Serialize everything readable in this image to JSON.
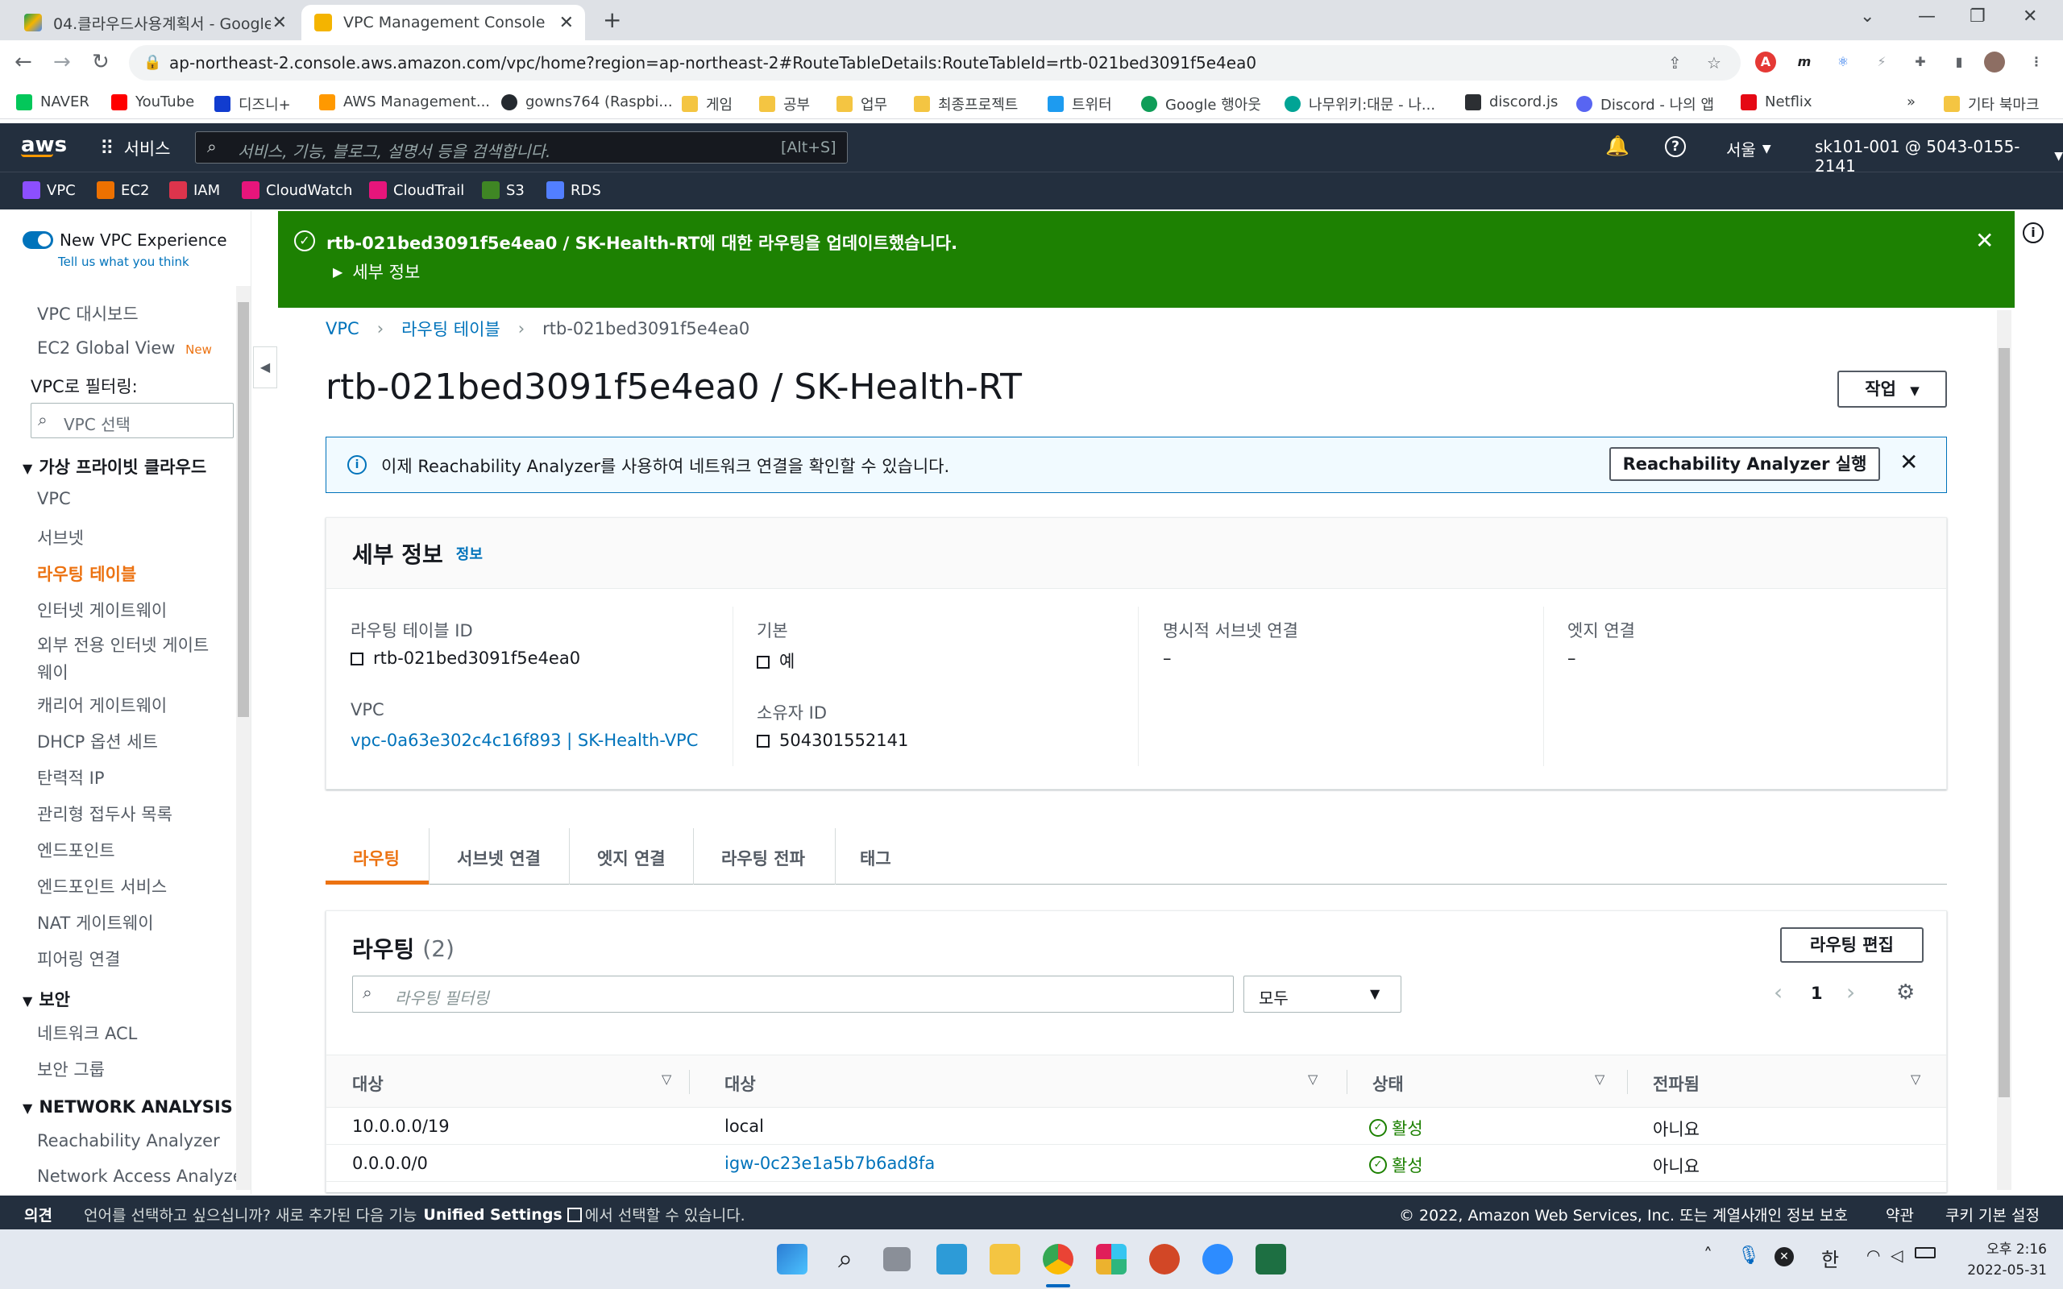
{
  "browser": {
    "tabs": [
      {
        "title": "04.클라우드사용계획서 - Google"
      },
      {
        "title": "VPC Management Console"
      }
    ],
    "url": "ap-northeast-2.console.aws.amazon.com/vpc/home?region=ap-northeast-2#RouteTableDetails:RouteTableId=rtb-021bed3091f5e4ea0",
    "bookmarks": [
      "NAVER",
      "YouTube",
      "디즈니+",
      "AWS Management...",
      "gowns764 (Raspbi...",
      "게임",
      "공부",
      "업무",
      "최종프로젝트",
      "트위터",
      "Google 행아웃",
      "나무위키:대문 - 나...",
      "discord.js",
      "Discord - 나의 앱",
      "Netflix",
      "기타 북마크"
    ],
    "more_bookmarks": "»"
  },
  "aws_header": {
    "logo": "aws",
    "services_label": "서비스",
    "search_placeholder": "서비스, 기능, 블로그, 설명서 등을 검색합니다.",
    "search_shortcut": "[Alt+S]",
    "region": "서울",
    "account": "sk101-001 @ 5043-0155-2141",
    "favorites": [
      "VPC",
      "EC2",
      "IAM",
      "CloudWatch",
      "CloudTrail",
      "S3",
      "RDS"
    ]
  },
  "sidebar": {
    "new_vpc_experience": "New VPC Experience",
    "tell_us": "Tell us what you think",
    "vpc_dashboard": "VPC 대시보드",
    "ec2_global_view": "EC2 Global View",
    "new_badge": "New",
    "filter_label": "VPC로 필터링:",
    "filter_placeholder": "VPC 선택",
    "section_vpc": "가상 프라이빗 클라우드",
    "vpc_items": [
      "VPC",
      "서브넷",
      "라우팅 테이블",
      "인터넷 게이트웨이",
      "외부 전용 인터넷 게이트",
      "웨이",
      "캐리어 게이트웨이",
      "DHCP 옵션 세트",
      "탄력적 IP",
      "관리형 접두사 목록",
      "엔드포인트",
      "엔드포인트 서비스",
      "NAT 게이트웨이",
      "피어링 연결"
    ],
    "section_security": "보안",
    "security_items": [
      "네트워크 ACL",
      "보안 그룹"
    ],
    "section_network": "NETWORK ANALYSIS",
    "network_items": [
      "Reachability Analyzer",
      "Network Access Analyzer"
    ]
  },
  "banner": {
    "message": "rtb-021bed3091f5e4ea0 / SK-Health-RT에 대한 라우팅을 업데이트했습니다.",
    "details": "세부 정보"
  },
  "breadcrumb": [
    "VPC",
    "라우팅 테이블",
    "rtb-021bed3091f5e4ea0"
  ],
  "page": {
    "title": "rtb-021bed3091f5e4ea0 / SK-Health-RT",
    "actions_button": "작업"
  },
  "info_alert": {
    "text": "이제 Reachability Analyzer를 사용하여 네트워크 연결을 확인할 수 있습니다.",
    "button": "Reachability Analyzer 실행"
  },
  "details": {
    "heading": "세부 정보",
    "info_link": "정보",
    "route_table_id_label": "라우팅 테이블 ID",
    "route_table_id": "rtb-021bed3091f5e4ea0",
    "vpc_label": "VPC",
    "vpc_value": "vpc-0a63e302c4c16f893 | SK-Health-VPC",
    "main_label": "기본",
    "main_value": "예",
    "owner_label": "소유자 ID",
    "owner_value": "504301552141",
    "explicit_subnet_label": "명시적 서브넷 연결",
    "explicit_subnet_value": "–",
    "edge_label": "엣지 연결",
    "edge_value": "–"
  },
  "tabs": [
    "라우팅",
    "서브넷 연결",
    "엣지 연결",
    "라우팅 전파",
    "태그"
  ],
  "routes": {
    "heading": "라우팅",
    "count": "(2)",
    "edit_button": "라우팅 편집",
    "filter_placeholder": "라우팅 필터링",
    "select_value": "모두",
    "page_number": "1",
    "columns": [
      "대상",
      "대상",
      "상태",
      "전파됨"
    ],
    "rows": [
      {
        "destination": "10.0.0.0/19",
        "target": "local",
        "status": "활성",
        "propagated": "아니요"
      },
      {
        "destination": "0.0.0.0/0",
        "target": "igw-0c23e1a5b7b6ad8fa",
        "status": "활성",
        "propagated": "아니요"
      }
    ]
  },
  "footer": {
    "feedback": "의견",
    "language_text_1": "언어를 선택하고 싶으십니까? 새로 추가된 다음 기능",
    "unified_settings": "Unified Settings",
    "language_text_2": "에서 선택할 수 있습니다.",
    "copyright": "© 2022, Amazon Web Services, Inc. 또는 계열사.",
    "privacy": "개인 정보 보호",
    "terms": "약관",
    "cookie": "쿠키 기본 설정"
  },
  "taskbar": {
    "ime": "한",
    "time": "오후 2:16",
    "date": "2022-05-31"
  },
  "colors": {
    "aws_nav": "#232f3e",
    "success": "#1d8102",
    "link": "#0073bb",
    "active_orange": "#ec7211"
  }
}
